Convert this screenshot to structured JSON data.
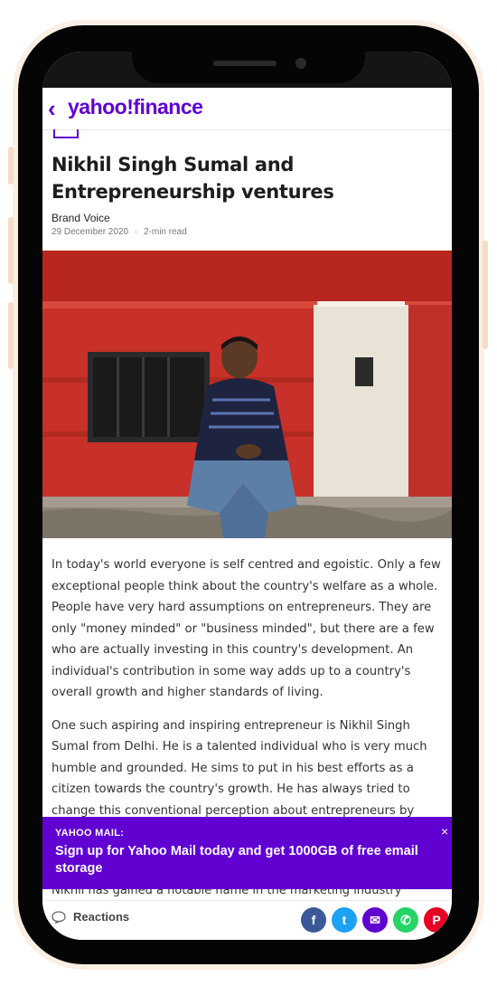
{
  "header": {
    "back_glyph": "‹",
    "logo_yahoo": "yahoo!",
    "logo_finance": "finance"
  },
  "article": {
    "title": "Nikhil Singh Sumal and Entrepreneurship ventures",
    "byline": "Brand Voice",
    "date": "29 December 2020",
    "separator": "·",
    "read_time": "2-min read",
    "paragraphs": [
      "In today's world everyone is self centred and egoistic. Only a few exceptional people think about the country's welfare as a whole. People have very hard assumptions on entrepreneurs. They are only \"money minded\" or \"business minded\", but there are a few who are actually investing in this country's development. An individual's contribution in some way adds up to a country's overall growth and higher standards of living.",
      "One such aspiring and inspiring entrepreneur is Nikhil Singh Sumal from Delhi. He is a talented individual who is very much humble and grounded. He sims to put in his best efforts as a citizen towards the country's growth. He has always tried to change this conventional perception about entrepreneurs by helping others to"
    ],
    "cut_line": "Nikhil has gained a notable name in the marketing industry through"
  },
  "mail_banner": {
    "label": "YAHOO MAIL:",
    "text": "Sign up for Yahoo Mail today and get 1000GB of free email storage",
    "close": "×"
  },
  "footer": {
    "reactions_label": "Reactions",
    "share": [
      {
        "icon": "facebook-icon",
        "glyph": "f",
        "color": "#3b5998"
      },
      {
        "icon": "twitter-icon",
        "glyph": "t",
        "color": "#1da1f2"
      },
      {
        "icon": "mail-icon",
        "glyph": "✉",
        "color": "#6001d2"
      },
      {
        "icon": "whatsapp-icon",
        "glyph": "✆",
        "color": "#25d366"
      },
      {
        "icon": "pinterest-icon",
        "glyph": "P",
        "color": "#e60023"
      }
    ]
  },
  "colors": {
    "brand": "#5f01d1",
    "frame": "#050505",
    "glow": "#fbeee3"
  }
}
